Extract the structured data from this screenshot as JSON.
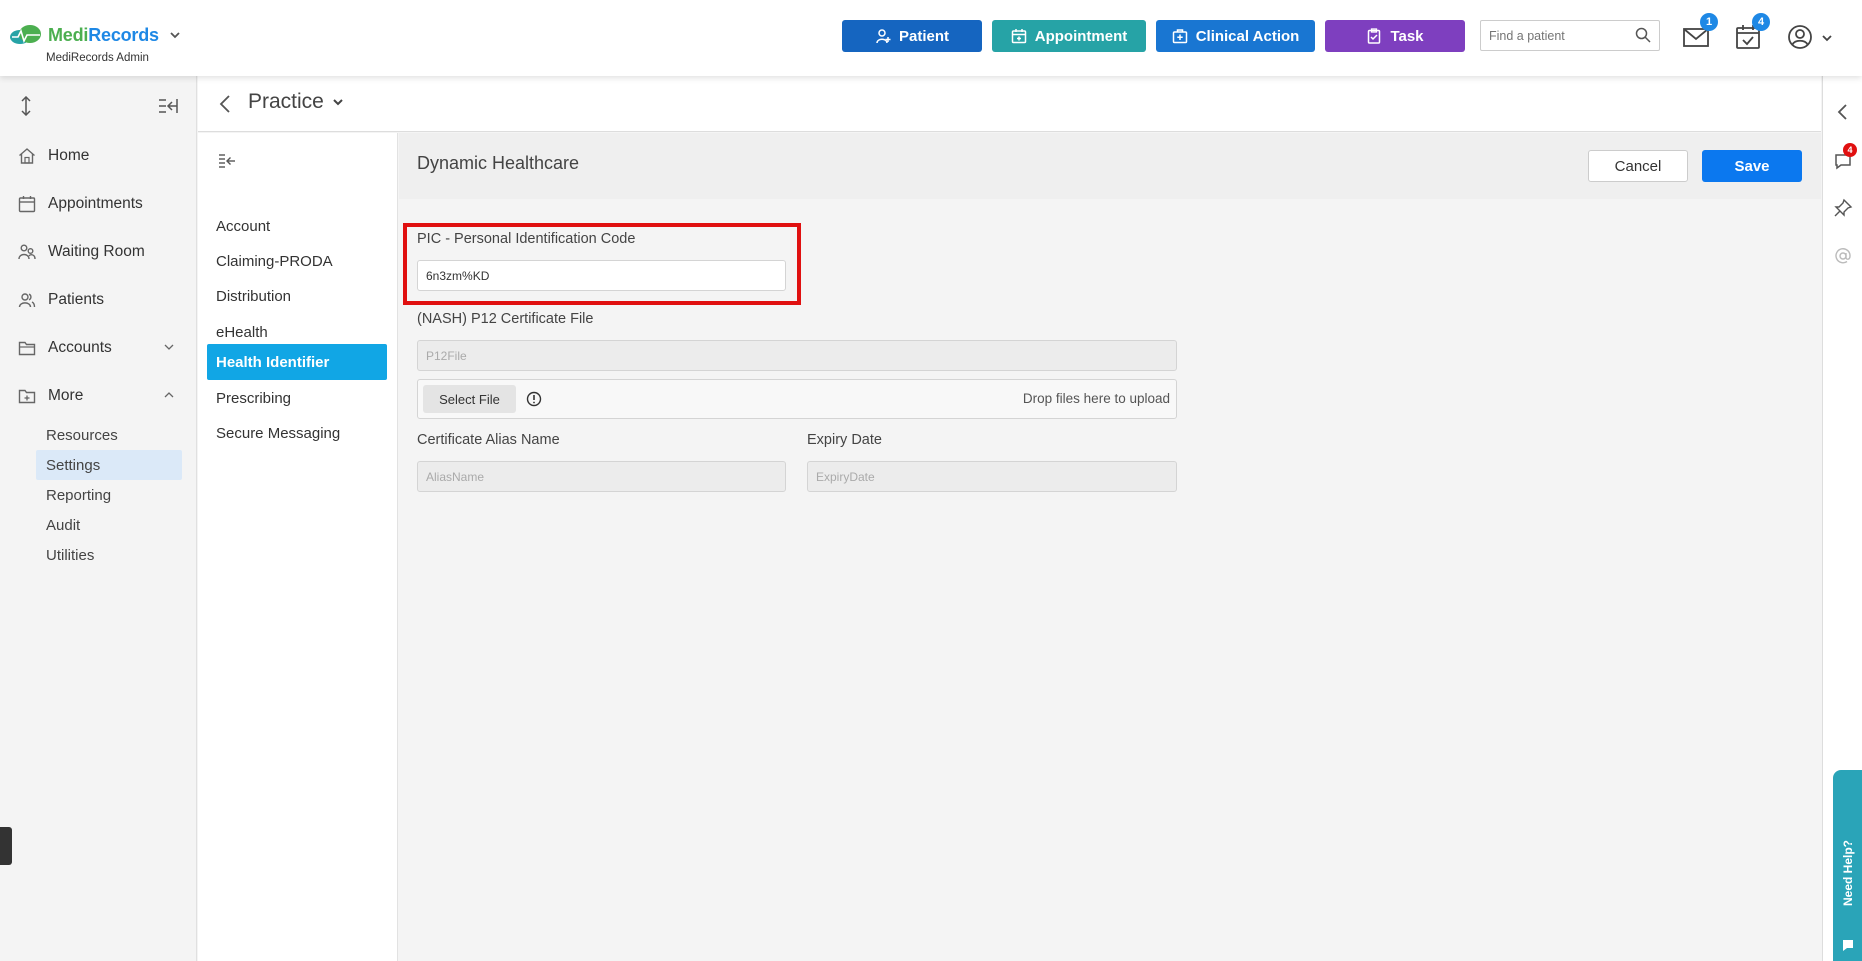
{
  "app": {
    "logo_medi": "Medi",
    "logo_records": "Records",
    "subtitle": "MediRecords Admin"
  },
  "topbar": {
    "patient_label": "Patient",
    "appointment_label": "Appointment",
    "clinical_action_label": "Clinical Action",
    "task_label": "Task",
    "search_placeholder": "Find a patient",
    "messages_badge": "1",
    "tasks_badge": "4"
  },
  "sidebar": {
    "items": [
      {
        "label": "Home",
        "icon": "home-icon"
      },
      {
        "label": "Appointments",
        "icon": "calendar-icon"
      },
      {
        "label": "Waiting Room",
        "icon": "waiting-room-icon"
      },
      {
        "label": "Patients",
        "icon": "users-icon"
      },
      {
        "label": "Accounts",
        "icon": "folder-icon"
      },
      {
        "label": "More",
        "icon": "folder-plus-icon"
      }
    ],
    "sub_items": [
      "Resources",
      "Settings",
      "Reporting",
      "Audit",
      "Utilities"
    ],
    "active_sub": "Settings"
  },
  "main": {
    "title": "Practice"
  },
  "settings_nav": {
    "items": [
      "Account",
      "Claiming-PRODA",
      "Distribution",
      "eHealth",
      "Health Identifier",
      "Prescribing",
      "Secure Messaging"
    ],
    "active": "Health Identifier"
  },
  "content": {
    "title": "Dynamic Healthcare",
    "cancel_label": "Cancel",
    "save_label": "Save",
    "pic_label": "PIC - Personal Identification Code",
    "pic_value": "6n3zm%KD",
    "cert_label": "(NASH) P12 Certificate File",
    "cert_placeholder": "P12File",
    "select_file_label": "Select File",
    "drop_text": "Drop files here to upload",
    "alias_label": "Certificate Alias Name",
    "alias_placeholder": "AliasName",
    "expiry_label": "Expiry Date",
    "expiry_placeholder": "ExpiryDate"
  },
  "rail": {
    "chat_badge": "4",
    "help_label": "Need Help?"
  },
  "colors": {
    "patient": "#1565c0",
    "appointment": "#26a3a6",
    "clinical_action": "#1976d2",
    "task": "#7e3fbf",
    "save": "#0b78ef",
    "active_nav": "#11a6e5",
    "highlight": "#e01010"
  }
}
